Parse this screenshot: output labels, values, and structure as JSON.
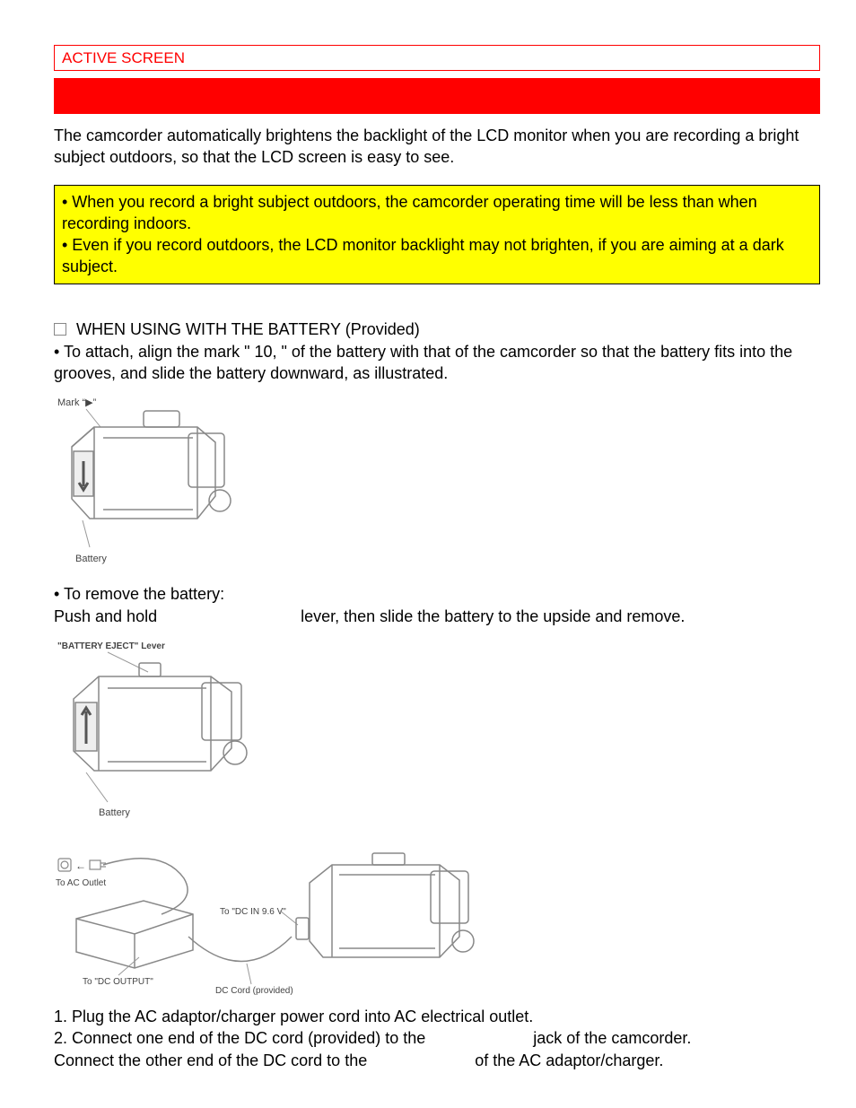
{
  "header": {
    "label": "ACTIVE SCREEN"
  },
  "intro": {
    "text": "The camcorder automatically brightens the backlight of the LCD monitor when you are recording a bright subject outdoors, so that the LCD screen is easy to see."
  },
  "notes": {
    "line1": "• When you record a bright subject outdoors, the camcorder operating time will be less than when recording indoors.",
    "line2": "• Even if you record outdoors, the LCD monitor backlight may not brighten, if you are aiming at a dark subject."
  },
  "battery": {
    "heading": "WHEN USING WITH THE BATTERY (Provided)",
    "attach": "• To attach, align the mark \" 10, \" of the battery with that of the camcorder so that the battery fits into the grooves, and slide the battery downward, as illustrated.",
    "remove_intro": "• To remove the battery:",
    "remove_a": "Push and hold",
    "remove_b": "lever, then slide the battery to the upside and remove."
  },
  "figures": {
    "fig1_mark": "Mark “▶”",
    "fig1_battery": "Battery",
    "fig2_lever": "\"BATTERY EJECT\" Lever",
    "fig2_battery": "Battery",
    "fig3_outlet": "To AC Outlet",
    "fig3_dcoutput": "To \"DC OUTPUT\"",
    "fig3_dccord": "DC Cord (provided)",
    "fig3_dcin": "To \"DC IN 9.6 V\""
  },
  "ac": {
    "step1": "1. Plug the AC adaptor/charger power cord into AC electrical outlet.",
    "step2a": "2. Connect one end of the DC cord (provided) to the",
    "step2b": "jack of  the camcorder.",
    "step3a": "Connect the other end of the DC cord to the",
    "step3b": "of the AC adaptor/charger."
  }
}
